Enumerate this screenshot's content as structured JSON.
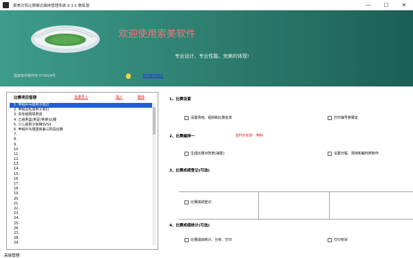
{
  "window": {
    "title": "索美对阵比赛模式编排管理系统  8.3.5  教练版",
    "min": "—",
    "max": "☐",
    "close": "✕"
  },
  "banner": {
    "welcome": "欢迎使用索美软件",
    "slogan": "专业设计、专业性能、完美的体现!",
    "copyright": "国家软件著作权 079424号",
    "help_link": "软件操作演示"
  },
  "left_panel": {
    "title": "比赛项目管理",
    "batch_import": "批量导入",
    "insert": "插入",
    "delete": "删除",
    "items": [
      "1.  甲组乒乓球男子单打",
      "2.  甲组羽毛球男子单打",
      "3.  青年组网球男双",
      "4.  乙组男篮(男足/男排)比赛",
      "5.  少儿组男子象棋3VS3",
      "6.  甲组乒乓球团体第三阶段比赛",
      "7.",
      "8.",
      "9.",
      "10.",
      "11.",
      "12.",
      "13.",
      "14.",
      "15.",
      "16.",
      "17.",
      "18.",
      "19.",
      "20.",
      "21.",
      "22.",
      "23.",
      "24.",
      "25.",
      "26.",
      "27.",
      "28.",
      "29."
    ]
  },
  "footer": "高级管理:",
  "right": {
    "s1_title": "1、比赛设置",
    "s1_opt1": "设置场地、组别和比赛名单",
    "s1_opt2": "打印抽号参赛证",
    "s2_title": "2、比赛编排一",
    "s2_note1": "逆时针轮转",
    "s2_note2": "带制",
    "s2_opt1": "生成比赛对阵表(抽签)",
    "s2_opt2": "设置日程、场地和裁判表制作",
    "s3_title": "3、比赛成绩登记(可选)",
    "s3_opt1": "比赛成绩登记",
    "s4_title": "4、比赛成绩统计(可选)",
    "s4_opt1": "比赛成绩统计、分析、打印",
    "s4_opt2": "打印奖状"
  },
  "colors": {
    "banner_start": "#3d9c8a",
    "banner_end": "#1c5e55",
    "welcome_text": "#f07878",
    "selected_row": "#1e5fd6",
    "link_red": "#e02020",
    "link_blue": "#2a2af0"
  }
}
